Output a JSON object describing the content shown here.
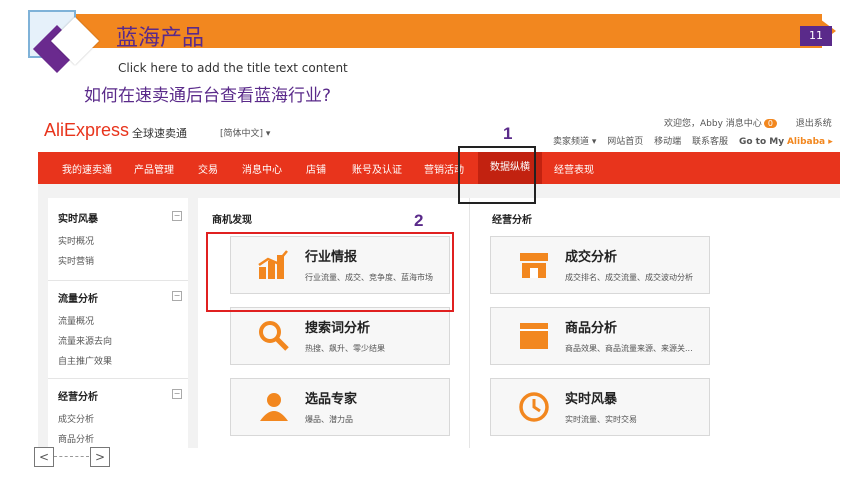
{
  "slide": {
    "title": "蓝海产品",
    "page_number": "11",
    "subtitle": "Click here to add the title text content",
    "question": "如何在速卖通后台查看蓝海行业?",
    "accent_color": "#f2871f",
    "purple_color": "#5a2a8a"
  },
  "aliexpress": {
    "logo": "AliExpress",
    "logo_sub": "全球速卖通",
    "language": "[简体中文] ▾",
    "welcome": "欢迎您，Abby",
    "message_center": "消息中心",
    "message_count": "0",
    "logout": "退出系统",
    "top_links": [
      "卖家频道 ▾",
      "网站首页",
      "移动端",
      "联系客服",
      "Go to My"
    ],
    "top_links_brand": "Alibaba ▸",
    "brand_color": "#e8341c",
    "nav": [
      "我的速卖通",
      "产品管理",
      "交易",
      "消息中心",
      "店铺",
      "账号及认证",
      "营销活动",
      "数据纵横",
      "经营表现"
    ],
    "left_panel": {
      "sections": [
        {
          "title": "实时风暴",
          "toggle": "−",
          "links": [
            "实时概况",
            "实时营销"
          ]
        },
        {
          "title": "流量分析",
          "toggle": "−",
          "links": [
            "流量概况",
            "流量来源去向",
            "自主推广效果"
          ]
        },
        {
          "title": "经营分析",
          "toggle": "−",
          "links": [
            "成交分析",
            "商品分析"
          ]
        }
      ]
    },
    "columns": {
      "left_heading": "商机发现",
      "right_heading": "经营分析"
    },
    "cards_left": [
      {
        "title": "行业情报",
        "desc": "行业流量、成交、竞争度、蓝海市场",
        "icon": "bar-chart-icon"
      },
      {
        "title": "搜索词分析",
        "desc": "热搜、飙升、零少结果",
        "icon": "magnifier-icon"
      },
      {
        "title": "选品专家",
        "desc": "爆品、潜力品",
        "icon": "person-icon"
      }
    ],
    "cards_right": [
      {
        "title": "成交分析",
        "desc": "成交排名、成交流量、成交波动分析",
        "icon": "shop-icon"
      },
      {
        "title": "商品分析",
        "desc": "商品效果、商品流量来源、来源关...",
        "icon": "box-icon"
      },
      {
        "title": "实时风暴",
        "desc": "实时流量、实时交易",
        "icon": "clock-icon"
      }
    ]
  },
  "annotations": {
    "step1": "1",
    "step2": "2"
  },
  "slide_nav": {
    "prev": "<",
    "next": ">"
  }
}
